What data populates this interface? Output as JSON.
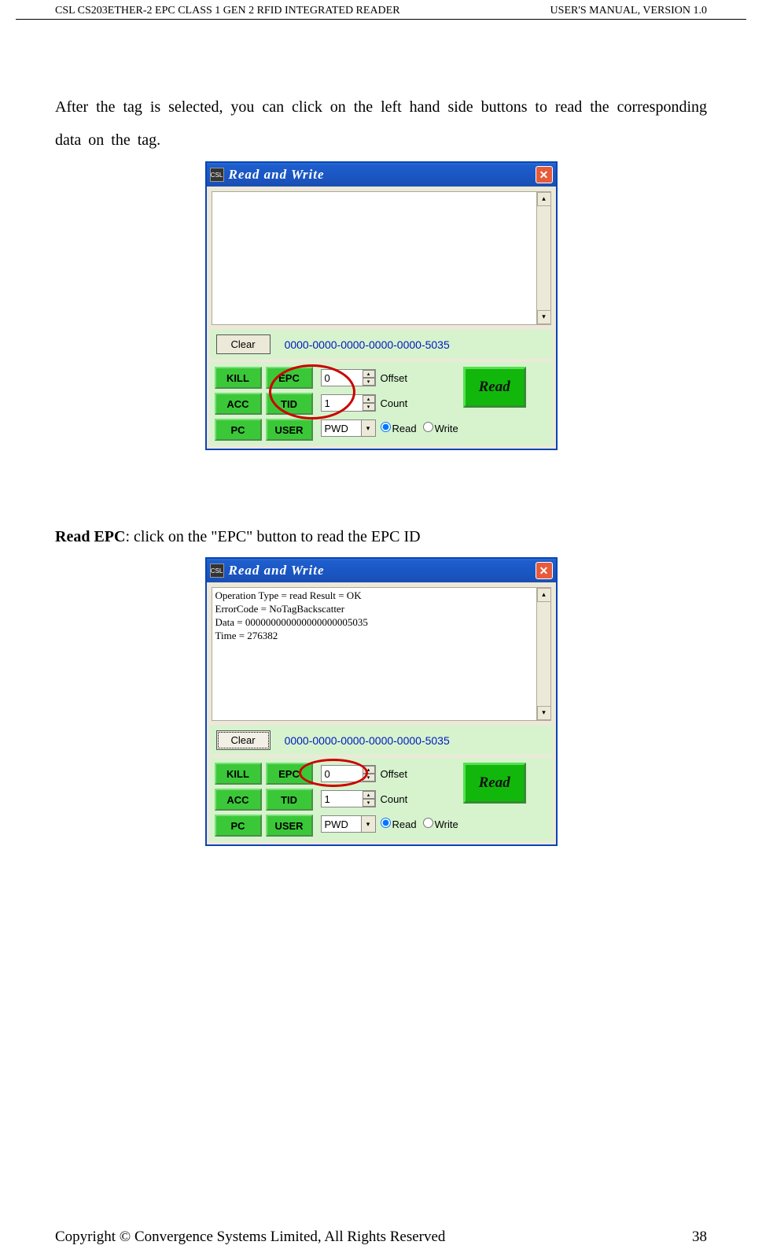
{
  "header": {
    "left": "CSL CS203ETHER-2 EPC CLASS 1 GEN 2 RFID INTEGRATED READER",
    "right": "USER'S  MANUAL,  VERSION  1.0"
  },
  "para1": "After the tag is selected, you can click on the left hand side buttons to read the corresponding data on the tag.",
  "para2_bold": "Read EPC",
  "para2_rest": ": click on the \"EPC\" button to read the EPC ID",
  "window": {
    "title": "Read and Write",
    "epc_display": "0000-0000-0000-0000-0000-5035",
    "clear": "Clear",
    "buttons": {
      "kill": "KILL",
      "epc": "EPC",
      "acc": "ACC",
      "tid": "TID",
      "pc": "PC",
      "user": "USER"
    },
    "offset": {
      "value": "0",
      "label": "Offset"
    },
    "count": {
      "value": "1",
      "label": "Count"
    },
    "pwd": {
      "value": "PWD"
    },
    "read_btn": "Read",
    "radio_read": "Read",
    "radio_write": "Write",
    "log2_lines": [
      "Operation Type = read   Result = OK",
      "ErrorCode = NoTagBackscatter",
      "Data = 000000000000000000005035",
      "Time = 276382"
    ]
  },
  "footer": {
    "left": "Copyright © Convergence Systems Limited, All Rights Reserved",
    "right": "38"
  }
}
